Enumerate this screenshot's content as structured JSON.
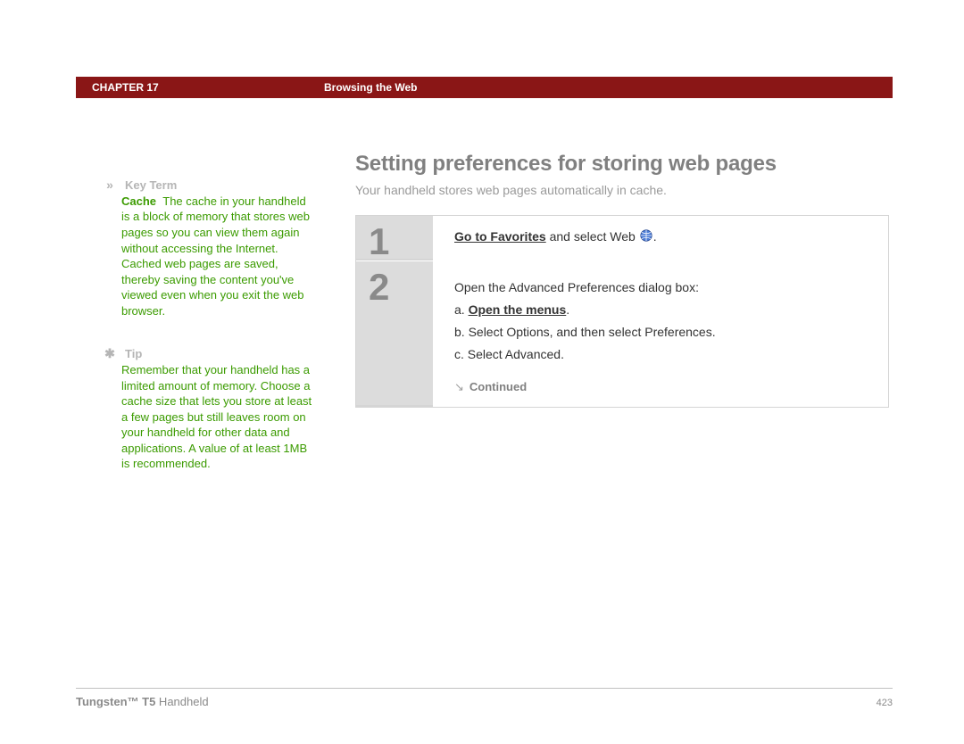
{
  "header": {
    "chapter": "CHAPTER 17",
    "title": "Browsing the Web"
  },
  "sidebar": {
    "keyterm": {
      "label": "Key Term",
      "term": "Cache",
      "body": "The cache in your handheld is a block of memory that stores web pages so you can view them again without accessing the Internet. Cached web pages are saved, thereby saving the content you've viewed even when you exit the web browser."
    },
    "tip": {
      "label": "Tip",
      "body": "Remember that your handheld has a limited amount of memory. Choose a cache size that lets you store at least a few pages but still leaves room on your handheld for other data and applications. A value of at least 1MB is recommended."
    }
  },
  "main": {
    "heading": "Setting preferences for storing web pages",
    "intro": "Your handheld stores web pages automatically in cache.",
    "steps": [
      {
        "num": "1",
        "lead_bold": "Go to Favorites",
        "lead_rest": " and select Web ",
        "tail": "."
      },
      {
        "num": "2",
        "intro": "Open the Advanced Preferences dialog box:",
        "a_prefix": "a.  ",
        "a_bold": "Open the menus",
        "a_tail": ".",
        "b": "b.  Select Options, and then select Preferences.",
        "c": "c.  Select Advanced.",
        "continued": "Continued"
      }
    ]
  },
  "footer": {
    "product_bold": "Tungsten™ T5",
    "product_rest": " Handheld",
    "page": "423"
  }
}
